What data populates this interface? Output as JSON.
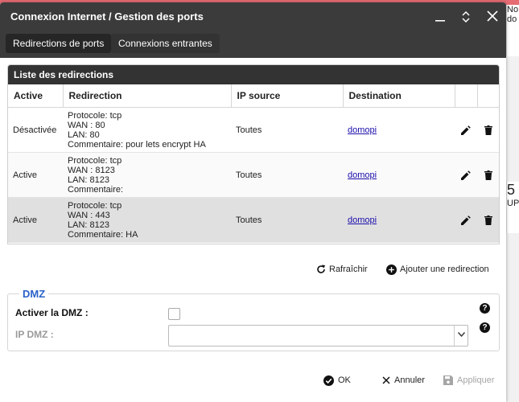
{
  "window": {
    "title": "Connexion Internet / Gestion des ports"
  },
  "tabs": [
    {
      "label": "Redirections de ports",
      "active": true
    },
    {
      "label": "Connexions entrantes",
      "active": false
    }
  ],
  "list": {
    "title": "Liste des redirections",
    "columns": [
      "Active",
      "Redirection",
      "IP source",
      "Destination"
    ],
    "rows": [
      {
        "active": "Désactivée",
        "redirection": [
          "Protocole: tcp",
          "WAN : 80",
          "LAN: 80",
          "Commentaire: pour lets encrypt HA"
        ],
        "ip_source": "Toutes",
        "destination": "domopi"
      },
      {
        "active": "Active",
        "redirection": [
          "Protocole: tcp",
          "WAN : 8123",
          "LAN: 8123",
          "Commentaire:"
        ],
        "ip_source": "Toutes",
        "destination": "domopi"
      },
      {
        "active": "Active",
        "redirection": [
          "Protocole: tcp",
          "WAN : 443",
          "LAN: 8123",
          "Commentaire: HA"
        ],
        "ip_source": "Toutes",
        "destination": "domopi"
      }
    ]
  },
  "actions": {
    "refresh": "Rafraîchir",
    "add": "Ajouter une redirection"
  },
  "dmz": {
    "legend": "DMZ",
    "enable_label": "Activer la DMZ :",
    "ip_label": "IP DMZ :",
    "enabled": false,
    "ip_value": ""
  },
  "footer": {
    "ok": "OK",
    "cancel": "Annuler",
    "apply": "Appliquer"
  },
  "background": {
    "frag1": "No",
    "frag2": "do",
    "frag3": "5",
    "frag4": "UP"
  },
  "colors": {
    "titlebar": "#3b3b3b",
    "accent": "#2a62c9",
    "selected_row": "#e0e0e0"
  }
}
